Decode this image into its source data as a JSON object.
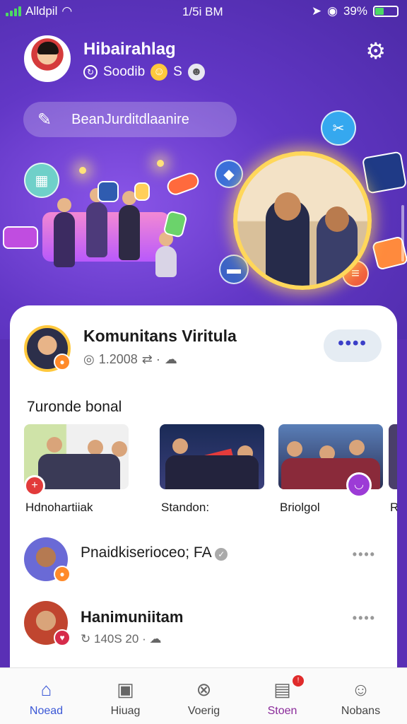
{
  "status_bar": {
    "carrier": "Alldpil",
    "time": "1/5i BM",
    "battery": "39%",
    "battery_level": 0.39
  },
  "profile": {
    "name": "Hibairahlag",
    "subtitle": "Soodib",
    "subtitle_extra": "S"
  },
  "search": {
    "label": "BeanJurditdlaanire"
  },
  "community": {
    "title": "Komunitans Viritula",
    "meta": "1.2008",
    "more_label": "••••"
  },
  "section": {
    "title": "7uronde bonal"
  },
  "thumbnails": [
    {
      "label": "Hdnohartiiak"
    },
    {
      "label": "Standon:"
    },
    {
      "label": "Briolgol"
    },
    {
      "label": "R"
    }
  ],
  "list": [
    {
      "title": "Pnaidkiserioceo; FA",
      "more": "••••"
    },
    {
      "title": "Hanimuniitam",
      "meta": "140S 20",
      "more": "••••"
    }
  ],
  "tabs": [
    {
      "label": "Noead",
      "icon": "home-icon"
    },
    {
      "label": "Hiuag",
      "icon": "gallery-icon"
    },
    {
      "label": "Voerig",
      "icon": "tools-icon"
    },
    {
      "label": "Stoen",
      "icon": "store-icon"
    },
    {
      "label": "Nobans",
      "icon": "profile-icon"
    }
  ],
  "colors": {
    "accent": "#3a57d6",
    "hero": "#6237c6",
    "badge": "#ff8a2a"
  }
}
